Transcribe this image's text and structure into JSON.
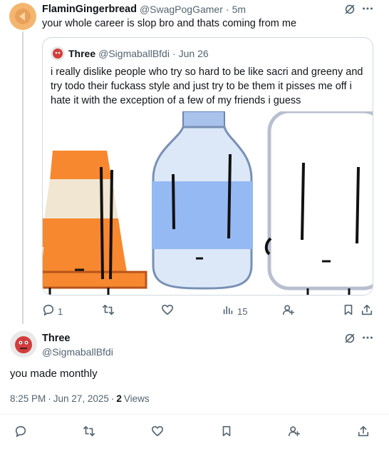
{
  "reply": {
    "author_name": "FlaminGingerbread",
    "author_handle": "@SwagPogGamer",
    "time": "5m",
    "text": "your whole career is slop bro and thats coming from me",
    "actions": {
      "replies": "",
      "reposts": "",
      "likes": "",
      "views": ""
    }
  },
  "quoted": {
    "author_name": "Three",
    "author_handle": "@SigmaballBfdi",
    "date": "Jun 26",
    "text": "i really dislike people who try so hard to be like sacri and greeny and try todo their fuckass style and just try to be them it pisses me off i hate it with the exception of a few of my friends i guess",
    "actions": {
      "replies": "1",
      "reposts": "",
      "likes": "",
      "views": "15"
    }
  },
  "main": {
    "author_name": "Three",
    "author_handle": "@SigmaballBfdi",
    "text": "you made monthly",
    "time": "8:25 PM",
    "date": "Jun 27, 2025",
    "views_count": "2",
    "views_label": "Views"
  },
  "separators": {
    "dot": "·"
  },
  "colors": {
    "cone_orange": "#f7882f",
    "cone_stripe": "#f0e6d2",
    "bottle_blue": "#dce8f8",
    "label_blue": "#95b9f2",
    "avatar_red": "#d33c3c"
  }
}
